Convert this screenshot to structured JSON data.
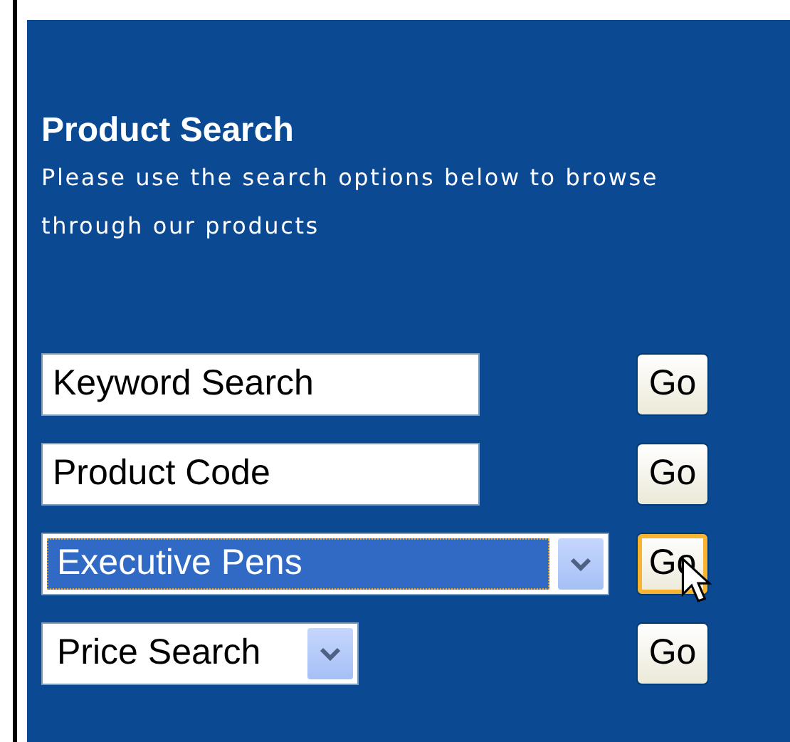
{
  "heading": "Product Search",
  "description": "Please use the search options below to browse through our products",
  "rows": [
    {
      "kind": "text",
      "value": "Keyword Search",
      "focused": false,
      "button": {
        "label": "Go",
        "hover": false
      }
    },
    {
      "kind": "text",
      "value": "Product Code",
      "focused": false,
      "button": {
        "label": "Go",
        "hover": false
      }
    },
    {
      "kind": "select",
      "value": "Executive Pens",
      "focused": true,
      "button": {
        "label": "Go",
        "hover": true
      }
    },
    {
      "kind": "select",
      "value": "Price Search",
      "focused": false,
      "button": {
        "label": "Go",
        "hover": false
      }
    }
  ]
}
